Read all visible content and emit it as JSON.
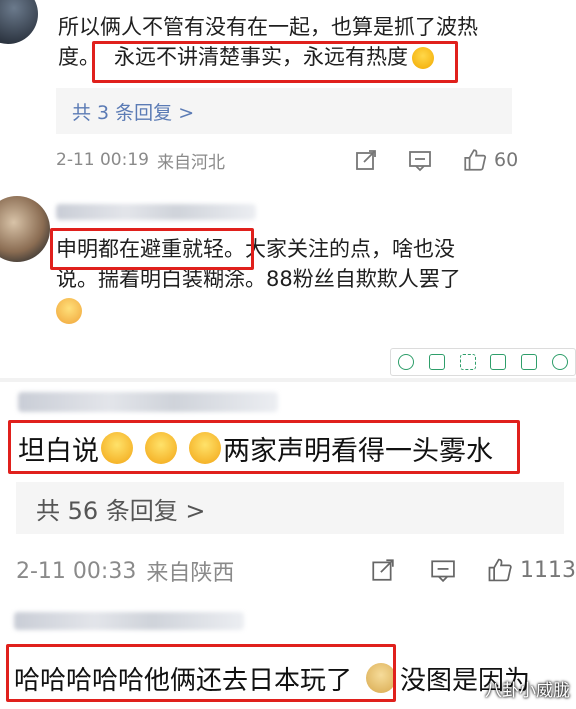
{
  "comment1": {
    "text_line1": "所以俩人不管有没有在一起，也算是抓了波热",
    "text_line2_prefix": "度。",
    "highlight": "永远不讲清楚事实，永远有热度",
    "reply_link": "共 3 条回复 >",
    "time": "2-11 00:19",
    "location": "来自河北",
    "likes": "60"
  },
  "comment2": {
    "highlight": "申明都在避重就轻",
    "text_rest_line1": "。大家关注的点，啥也没",
    "text_line2": "说。揣着明白装糊涂。88粉丝自欺欺人罢了"
  },
  "comment3": {
    "highlight_prefix": "坦白说",
    "highlight_suffix": "两家声明看得一头雾水",
    "reply_link": "共 56 条回复 >",
    "time": "2-11 00:33",
    "location": "来自陕西",
    "likes": "1113"
  },
  "comment4": {
    "highlight": "哈哈哈哈哈他俩还去日本玩了",
    "text_rest": "没图是因为"
  },
  "watermark": "八卦小威胧",
  "colors": {
    "highlight_border": "#e0201c",
    "reply_link": "#5b7bb5",
    "toolbar_icon": "#2e9e6a"
  }
}
